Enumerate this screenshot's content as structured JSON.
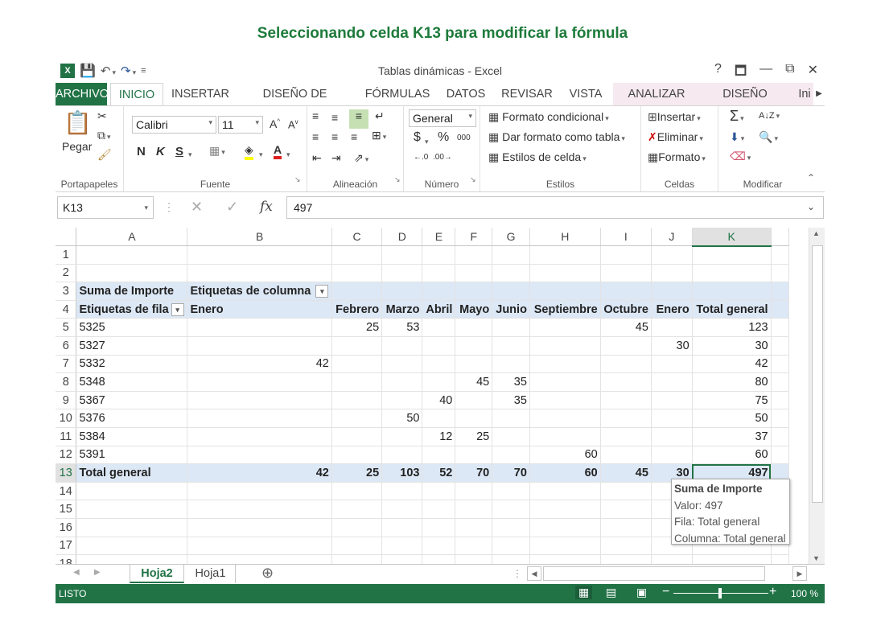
{
  "caption": "Seleccionando celda K13 para modificar la fórmula",
  "window": {
    "title": "Tablas dinámicas - Excel",
    "help": "?",
    "minimize": "—",
    "close": "✕"
  },
  "tabs": [
    "ARCHIVO",
    "INICIO",
    "INSERTAR",
    "DISEÑO DE PÁGINA",
    "FÓRMULAS",
    "DATOS",
    "REVISAR",
    "VISTA",
    "ANALIZAR",
    "DISEÑO",
    "Ini"
  ],
  "ribbon": {
    "portapapeles": {
      "paste": "Pegar",
      "label": "Portapapeles"
    },
    "fuente": {
      "font": "Calibri",
      "size": "11",
      "bold": "N",
      "italic": "K",
      "underline": "S",
      "label": "Fuente"
    },
    "alineacion": {
      "label": "Alineación"
    },
    "numero": {
      "format": "General",
      "currency": "$",
      "percent": "%",
      "thousands": "000",
      "label": "Número"
    },
    "estilos": {
      "conditional": "Formato condicional",
      "table": "Dar formato como tabla",
      "cell": "Estilos de celda",
      "label": "Estilos"
    },
    "celdas": {
      "insert": "Insertar",
      "delete": "Eliminar",
      "format": "Formato",
      "label": "Celdas"
    },
    "modificar": {
      "label": "Modificar"
    }
  },
  "formula_bar": {
    "name_box": "K13",
    "fx": "fx",
    "value": "497"
  },
  "sheet": {
    "columns": [
      "A",
      "B",
      "C",
      "D",
      "E",
      "F",
      "G",
      "H",
      "I",
      "J",
      "K"
    ],
    "selected_column": "K",
    "selected_row": "13",
    "rows": [
      {
        "n": "1",
        "cells": [
          "",
          "",
          "",
          "",
          "",
          "",
          "",
          "",
          "",
          "",
          ""
        ]
      },
      {
        "n": "2",
        "cells": [
          "",
          "",
          "",
          "",
          "",
          "",
          "",
          "",
          "",
          "",
          ""
        ]
      },
      {
        "n": "3",
        "cells": [
          "Suma de Importe",
          "Etiquetas de columna",
          "",
          "",
          "",
          "",
          "",
          "",
          "",
          "",
          ""
        ]
      },
      {
        "n": "4",
        "cells": [
          "Etiquetas de fila",
          "Enero",
          "Febrero",
          "Marzo",
          "Abril",
          "Mayo",
          "Junio",
          "Septiembre",
          "Octubre",
          "Enero",
          "Total general"
        ]
      },
      {
        "n": "5",
        "cells": [
          "5325",
          "",
          "25",
          "53",
          "",
          "",
          "",
          "",
          "45",
          "",
          "123"
        ]
      },
      {
        "n": "6",
        "cells": [
          "5327",
          "",
          "",
          "",
          "",
          "",
          "",
          "",
          "",
          "30",
          "30"
        ]
      },
      {
        "n": "7",
        "cells": [
          "5332",
          "42",
          "",
          "",
          "",
          "",
          "",
          "",
          "",
          "",
          "42"
        ]
      },
      {
        "n": "8",
        "cells": [
          "5348",
          "",
          "",
          "",
          "",
          "45",
          "35",
          "",
          "",
          "",
          "80"
        ]
      },
      {
        "n": "9",
        "cells": [
          "5367",
          "",
          "",
          "",
          "40",
          "",
          "35",
          "",
          "",
          "",
          "75"
        ]
      },
      {
        "n": "10",
        "cells": [
          "5376",
          "",
          "",
          "50",
          "",
          "",
          "",
          "",
          "",
          "",
          "50"
        ]
      },
      {
        "n": "11",
        "cells": [
          "5384",
          "",
          "",
          "",
          "12",
          "25",
          "",
          "",
          "",
          "",
          "37"
        ]
      },
      {
        "n": "12",
        "cells": [
          "5391",
          "",
          "",
          "",
          "",
          "",
          "",
          "60",
          "",
          "",
          "60"
        ]
      },
      {
        "n": "13",
        "cells": [
          "Total general",
          "42",
          "25",
          "103",
          "52",
          "70",
          "70",
          "60",
          "45",
          "30",
          "497"
        ]
      },
      {
        "n": "14",
        "cells": [
          "",
          "",
          "",
          "",
          "",
          "",
          "",
          "",
          "",
          "",
          ""
        ]
      },
      {
        "n": "15",
        "cells": [
          "",
          "",
          "",
          "",
          "",
          "",
          "",
          "",
          "",
          "",
          ""
        ]
      },
      {
        "n": "16",
        "cells": [
          "",
          "",
          "",
          "",
          "",
          "",
          "",
          "",
          "",
          "",
          ""
        ]
      },
      {
        "n": "17",
        "cells": [
          "",
          "",
          "",
          "",
          "",
          "",
          "",
          "",
          "",
          "",
          ""
        ]
      },
      {
        "n": "18",
        "cells": [
          "",
          "",
          "",
          "",
          "",
          "",
          "",
          "",
          "",
          "",
          ""
        ]
      }
    ]
  },
  "tooltip": {
    "title": "Suma de Importe",
    "line1": "Valor: 497",
    "line2": "Fila: Total general",
    "line3": "Columna: Total general"
  },
  "sheet_tabs": [
    "Hoja2",
    "Hoja1"
  ],
  "status": {
    "mode": "LISTO",
    "zoom": "100 %"
  },
  "colors": {
    "excel_green": "#217346",
    "pivot_blue": "#dde8f6",
    "context_pink": "#f6e9f0"
  }
}
